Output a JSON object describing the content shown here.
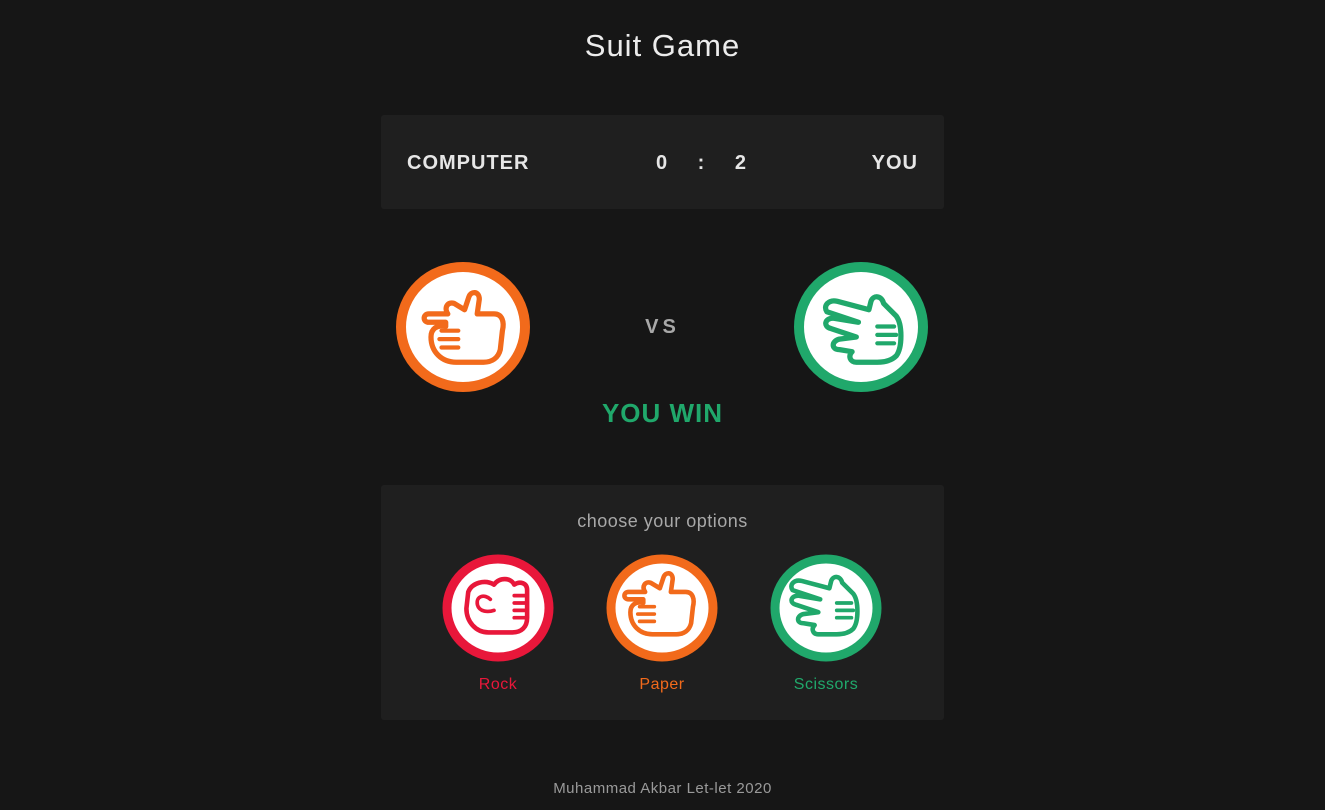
{
  "title": "Suit Game",
  "scoreboard": {
    "computer_label": "COMPUTER",
    "player_label": "YOU",
    "computer_score": "0",
    "separator": ":",
    "player_score": "2"
  },
  "arena": {
    "computer_choice": "paper",
    "player_choice": "scissors",
    "vs_text": "VS",
    "result_text": "YOU WIN"
  },
  "options": {
    "title": "choose your options",
    "items": [
      {
        "id": "rock",
        "label": "Rock",
        "icon": "rock-hand-icon",
        "color": "#e8173a"
      },
      {
        "id": "paper",
        "label": "Paper",
        "icon": "paper-hand-icon",
        "color": "#f26a1b"
      },
      {
        "id": "scissors",
        "label": "Scissors",
        "icon": "scissors-hand-icon",
        "color": "#20a86b"
      }
    ]
  },
  "colors": {
    "background": "#161616",
    "panel": "#1f1f1f",
    "rock": "#e8173a",
    "paper": "#f26a1b",
    "scissors": "#20a86b",
    "win": "#20a86b"
  },
  "footer": "Muhammad Akbar Let-let 2020"
}
